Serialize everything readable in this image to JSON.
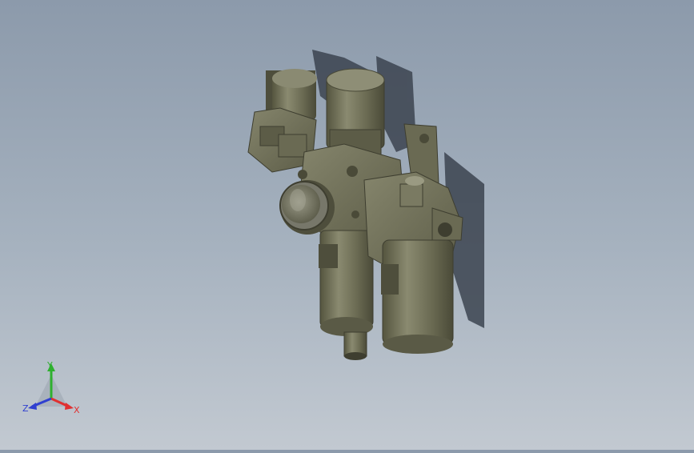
{
  "scene": {
    "background_top": "#8c9aab",
    "background_bottom": "#c2c9d1",
    "part_color": "#6e6e58",
    "part_dark": "#4a4a3a",
    "part_light": "#8f8f76",
    "shadow_color": "#3c4450"
  },
  "triad": {
    "x_label": "X",
    "y_label": "Y",
    "z_label": "Z",
    "x_color": "#e03030",
    "y_color": "#2fb02f",
    "z_color": "#2f3fd0"
  }
}
